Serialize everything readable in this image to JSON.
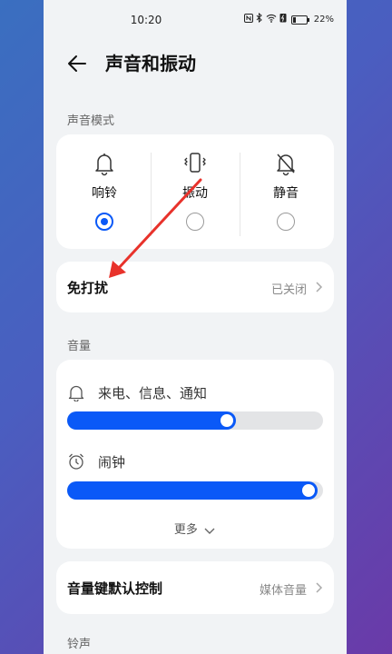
{
  "status_bar": {
    "time": "10:20",
    "battery_percent": "22%",
    "icons": [
      "nfc-icon",
      "bluetooth-icon",
      "wifi-icon",
      "battery-saver-icon",
      "battery-icon"
    ]
  },
  "header": {
    "title": "声音和振动",
    "back_icon": "back-arrow-icon"
  },
  "sound_mode": {
    "section_label": "声音模式",
    "options": [
      {
        "label": "响铃",
        "icon": "bell-icon",
        "selected": true
      },
      {
        "label": "振动",
        "icon": "vibrate-icon",
        "selected": false
      },
      {
        "label": "静音",
        "icon": "bell-off-icon",
        "selected": false
      }
    ]
  },
  "do_not_disturb": {
    "label": "免打扰",
    "value": "已关闭"
  },
  "volume": {
    "section_label": "音量",
    "sliders": [
      {
        "label": "来电、信息、通知",
        "icon": "bell-icon",
        "level": 0.66
      },
      {
        "label": "闹钟",
        "icon": "alarm-clock-icon",
        "level": 0.98
      }
    ],
    "more_label": "更多"
  },
  "volume_key": {
    "label": "音量键默认控制",
    "value": "媒体音量"
  },
  "ringtone": {
    "section_label": "铃声"
  },
  "colors": {
    "accent": "#0a59f7",
    "annotation_arrow": "#e8322b"
  }
}
